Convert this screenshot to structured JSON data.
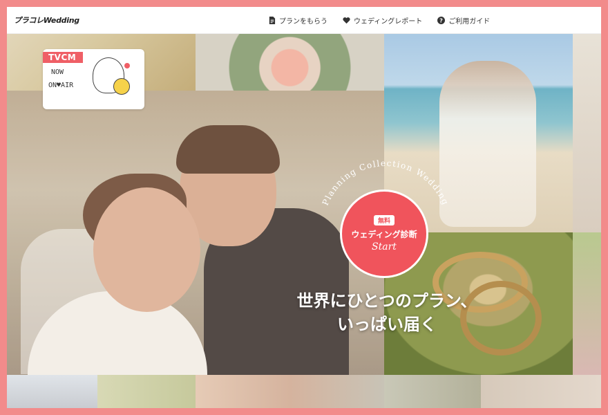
{
  "header": {
    "logo": "プラコレWedding",
    "nav": [
      {
        "label": "プランをもらう",
        "icon": "document-icon"
      },
      {
        "label": "ウェディングレポート",
        "icon": "heart-icon"
      },
      {
        "label": "ご利用ガイド",
        "icon": "help-icon"
      }
    ]
  },
  "tvcm": {
    "label": "TVCM",
    "now": "NOW",
    "on_air": "ON♥AIR"
  },
  "hero": {
    "arc_text": "Planning Collection Wedding",
    "cta_badge": "無料",
    "cta_label": "ウェディング診断",
    "cta_start": "Start",
    "headline_line1": "世界にひとつのプラン、",
    "headline_line2": "いっぱい届く"
  },
  "colors": {
    "frame": "#f28b8b",
    "accent": "#f0545c"
  }
}
